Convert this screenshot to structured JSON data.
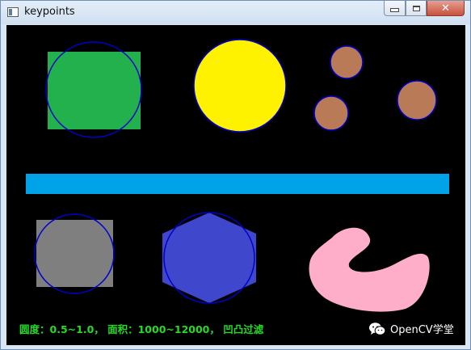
{
  "window": {
    "title": "keypoints",
    "controls": [
      "minimize-icon",
      "maximize-icon",
      "close-icon"
    ],
    "close_glyph": "✕"
  },
  "image": {
    "background": "#000000",
    "caption": "圆度：0.5~1.0， 面积：1000~12000， 凹凸过滤",
    "caption_color": "#22dd22",
    "watermark": "OpenCV学堂",
    "watermark_icon": "wechat-icon"
  },
  "colors": {
    "green_square": "#22b14c",
    "yellow_circle": "#fff200",
    "brown_circles": "#b97a57",
    "blue_bar": "#00a2e8",
    "gray_square": "#7f7f7f",
    "indigo_hexagon": "#3f48cc",
    "pink_blob": "#ffaec9",
    "keypoint_circle": "#0000cc"
  }
}
